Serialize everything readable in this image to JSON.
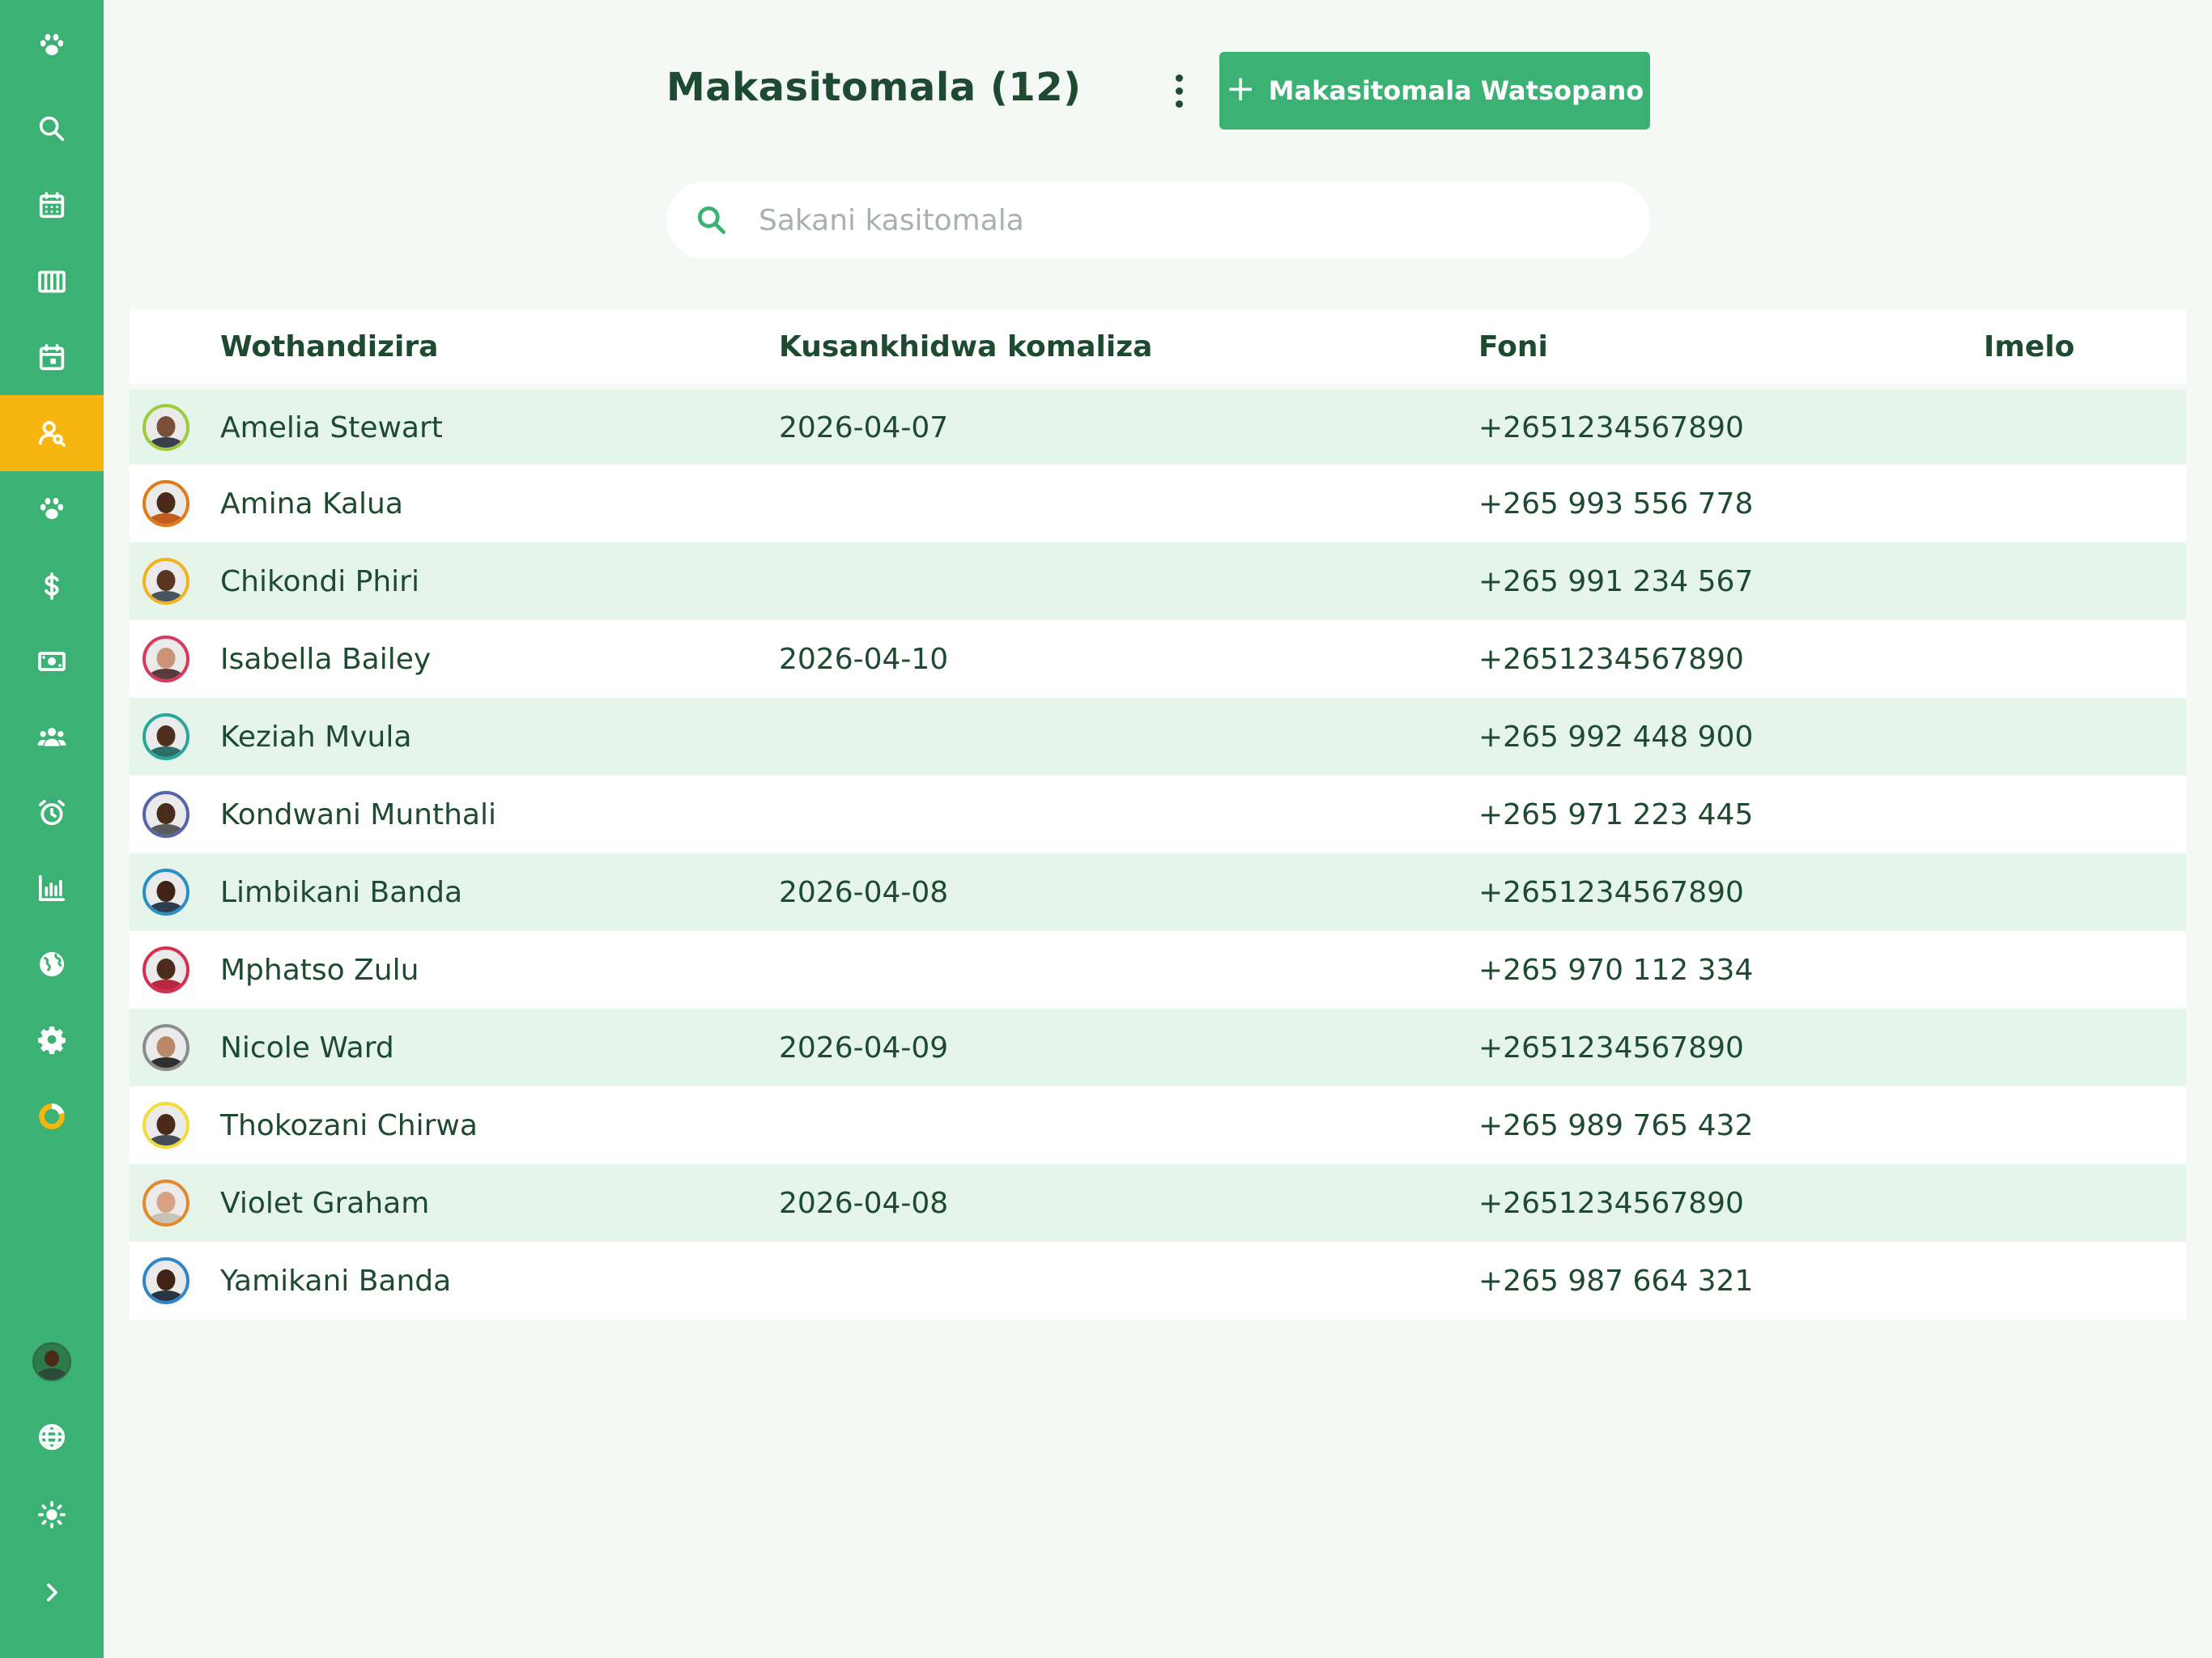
{
  "app": {
    "title": "Makasitomala",
    "count_label": "Makasitomala (12)"
  },
  "colors": {
    "primary": "#3bb273",
    "active_nav": "#f6b60f",
    "text": "#1d4a30",
    "row_alt": "#e6f5ea"
  },
  "sidebar": {
    "items": [
      {
        "icon": "paw-icon",
        "active": false
      },
      {
        "icon": "search-icon",
        "active": false
      },
      {
        "icon": "calendar-icon",
        "active": false
      },
      {
        "icon": "columns-icon",
        "active": false
      },
      {
        "icon": "calendar-day-icon",
        "active": false
      },
      {
        "icon": "customer-search-icon",
        "active": true
      },
      {
        "icon": "paw-icon",
        "active": false
      },
      {
        "icon": "dollar-icon",
        "active": false
      },
      {
        "icon": "cash-icon",
        "active": false
      },
      {
        "icon": "users-icon",
        "active": false
      },
      {
        "icon": "alarm-clock-icon",
        "active": false
      },
      {
        "icon": "bar-chart-icon",
        "active": false
      },
      {
        "icon": "globe-icon",
        "active": false
      },
      {
        "icon": "gear-icon",
        "active": false
      },
      {
        "icon": "progress-ring-icon",
        "active": false
      }
    ],
    "bottom": [
      {
        "icon": "user-avatar"
      },
      {
        "icon": "language-globe-icon"
      },
      {
        "icon": "sun-icon"
      },
      {
        "icon": "chevron-right-icon"
      }
    ]
  },
  "toolbar": {
    "add_label": "Makasitomala Watsopano",
    "more_icon": "more-vertical-icon"
  },
  "search": {
    "placeholder": "Sakani kasitomala",
    "value": ""
  },
  "table": {
    "columns": [
      "Wothandizira",
      "Kusankhidwa komaliza",
      "Foni",
      "Imelo"
    ],
    "rows": [
      {
        "name": "Amelia Stewart",
        "last_appointment": "2026-04-07",
        "phone": "+2651234567890",
        "email": "",
        "ring": "#9ccc3c",
        "skin": "#7a4f37",
        "shirt": "#3a3f4a"
      },
      {
        "name": "Amina Kalua",
        "last_appointment": "",
        "phone": "+265 993 556 778",
        "email": "",
        "ring": "#e07b1a",
        "skin": "#4a2b1a",
        "shirt": "#c15b1f"
      },
      {
        "name": "Chikondi Phiri",
        "last_appointment": "",
        "phone": "+265 991 234 567",
        "email": "",
        "ring": "#f2b320",
        "skin": "#5a3521",
        "shirt": "#4a5560"
      },
      {
        "name": "Isabella Bailey",
        "last_appointment": "2026-04-10",
        "phone": "+2651234567890",
        "email": "",
        "ring": "#d63b5e",
        "skin": "#c99478",
        "shirt": "#5a3b3b"
      },
      {
        "name": "Keziah Mvula",
        "last_appointment": "",
        "phone": "+265 992 448 900",
        "email": "",
        "ring": "#2aa79b",
        "skin": "#4e2e1d",
        "shirt": "#2f6e66"
      },
      {
        "name": "Kondwani Munthali",
        "last_appointment": "",
        "phone": "+265 971 223 445",
        "email": "",
        "ring": "#5565a8",
        "skin": "#4a2c1c",
        "shirt": "#5a5a5a"
      },
      {
        "name": "Limbikani Banda",
        "last_appointment": "2026-04-08",
        "phone": "+2651234567890",
        "email": "",
        "ring": "#2a8fc4",
        "skin": "#3f2416",
        "shirt": "#2d3e50"
      },
      {
        "name": "Mphatso Zulu",
        "last_appointment": "",
        "phone": "+265 970 112 334",
        "email": "",
        "ring": "#d6304f",
        "skin": "#4b2b1b",
        "shirt": "#b8263f"
      },
      {
        "name": "Nicole Ward",
        "last_appointment": "2026-04-09",
        "phone": "+2651234567890",
        "email": "",
        "ring": "#8c8c8c",
        "skin": "#b98868",
        "shirt": "#2f2f2f"
      },
      {
        "name": "Thokozani Chirwa",
        "last_appointment": "",
        "phone": "+265 989 765 432",
        "email": "",
        "ring": "#f3dc3a",
        "skin": "#4a2a19",
        "shirt": "#444c55"
      },
      {
        "name": "Violet Graham",
        "last_appointment": "2026-04-08",
        "phone": "+2651234567890",
        "email": "",
        "ring": "#e28a2a",
        "skin": "#d5a384",
        "shirt": "#c9c2b6"
      },
      {
        "name": "Yamikani Banda",
        "last_appointment": "",
        "phone": "+265 987 664 321",
        "email": "",
        "ring": "#2e86c9",
        "skin": "#3f2415",
        "shirt": "#2a3441"
      }
    ]
  }
}
